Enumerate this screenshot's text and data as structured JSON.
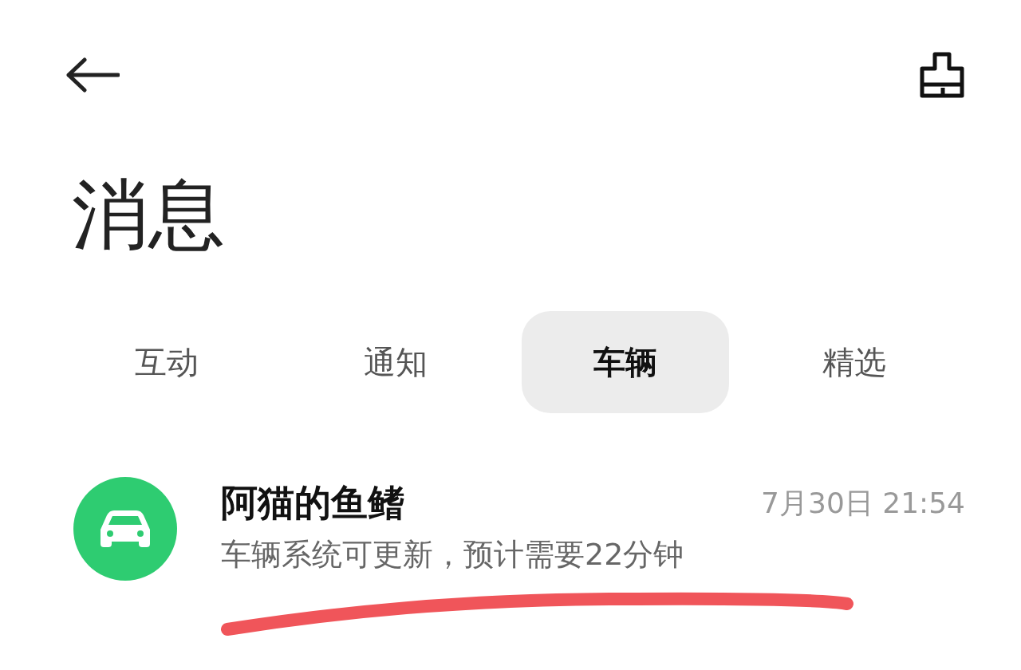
{
  "title": "消息",
  "tabs": [
    {
      "label": "互动",
      "selected": false
    },
    {
      "label": "通知",
      "selected": false
    },
    {
      "label": "车辆",
      "selected": true
    },
    {
      "label": "精选",
      "selected": false
    }
  ],
  "messages": [
    {
      "sender": "阿猫的鱼鳍",
      "time": "7月30日 21:54",
      "preview": "车辆系统可更新，预计需要22分钟"
    }
  ]
}
